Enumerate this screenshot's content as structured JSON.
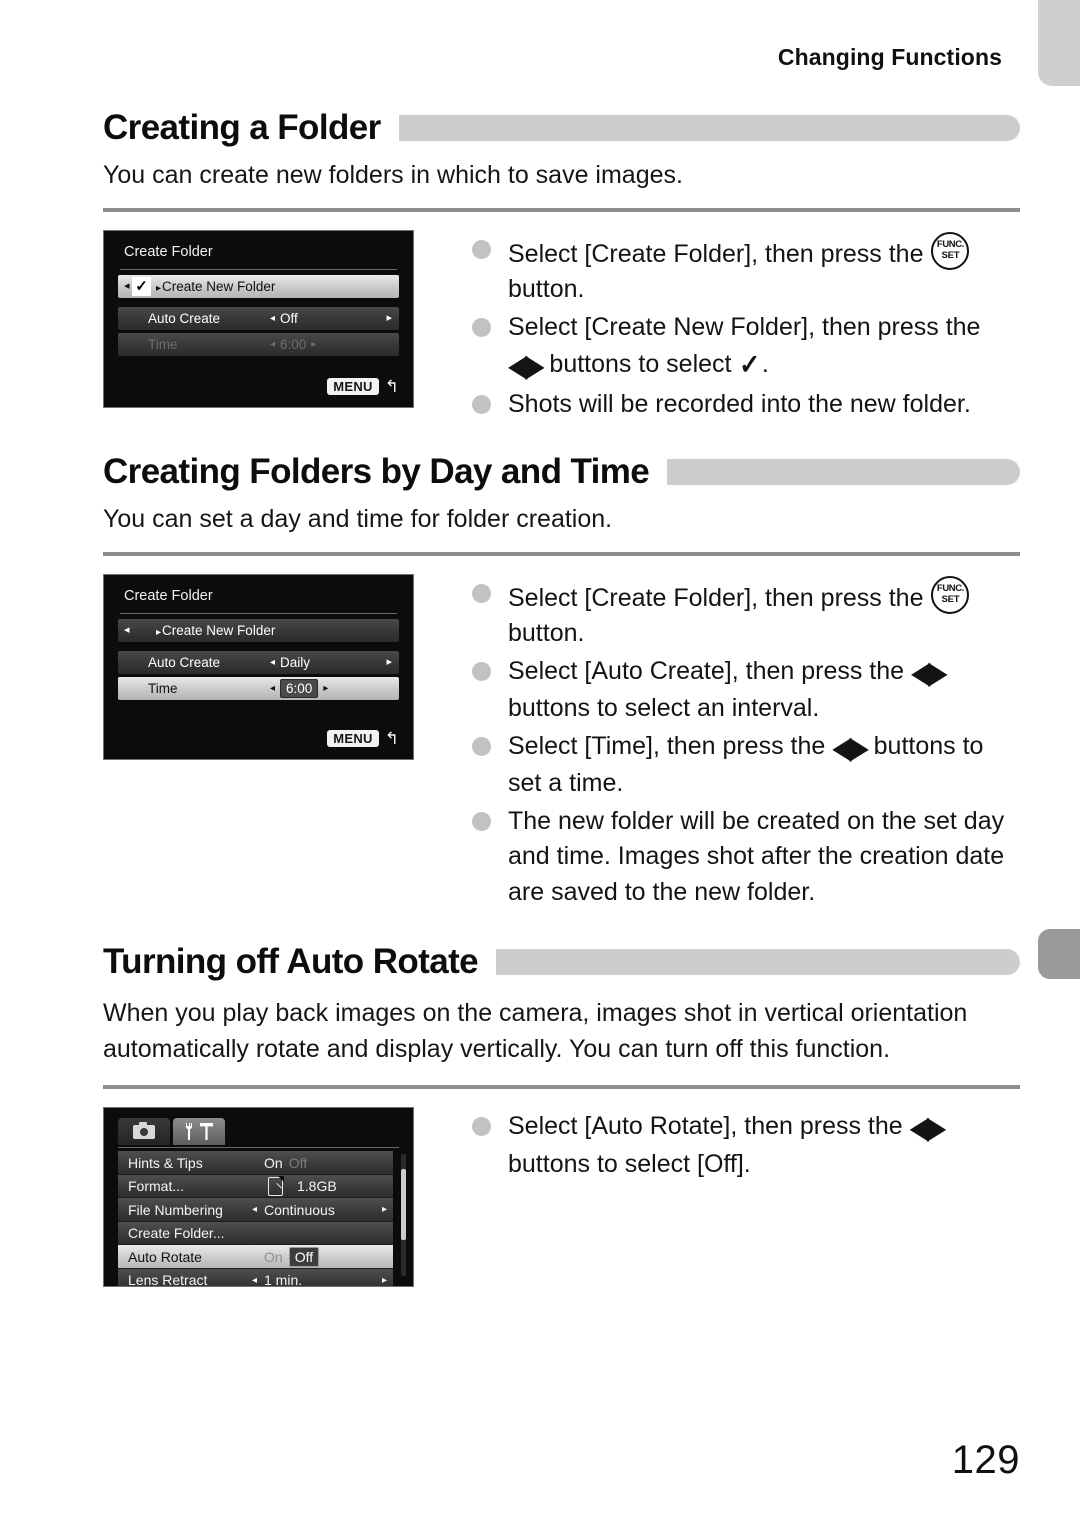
{
  "header": {
    "running_title": "Changing Functions"
  },
  "page_number": "129",
  "sections": [
    {
      "id": "creating-a-folder",
      "title": "Creating a Folder",
      "intro": "You can create new folders in which to save images.",
      "screen": {
        "title": "Create Folder",
        "rows": [
          {
            "label": "Create New Folder",
            "value": "",
            "state": "highlighted",
            "checked": true
          },
          {
            "label": "Auto Create",
            "value": "Off",
            "state": "normal",
            "checked": false
          },
          {
            "label": "Time",
            "value": "6:00",
            "state": "dimmed",
            "checked": false
          }
        ],
        "menu_button": "MENU"
      },
      "steps": [
        "Select [Create Folder], then press the FUNC-SET button.",
        "Select [Create New Folder], then press the LR buttons to select CHECK .",
        "Shots will be recorded into the new folder."
      ],
      "step_parts": [
        {
          "pre": "Select [Create Folder], then press the ",
          "icon": "func-set-icon",
          "post": " button."
        },
        {
          "pre": "Select [Create New Folder], then press the ",
          "icon": "left-right-arrows-icon",
          "post": " buttons to select ",
          "icon2": "checkmark-icon",
          "post2": "."
        },
        {
          "pre": "Shots will be recorded into the new folder.",
          "icon": "",
          "post": ""
        }
      ]
    },
    {
      "id": "creating-folders-by-day-and-time",
      "title": "Creating Folders by Day and Time",
      "intro": "You can set a day and time for folder creation.",
      "screen": {
        "title": "Create Folder",
        "rows": [
          {
            "label": "Create New Folder",
            "value": "",
            "state": "normal",
            "checked": false
          },
          {
            "label": "Auto Create",
            "value": "Daily",
            "state": "normal",
            "checked": false
          },
          {
            "label": "Time",
            "value": "6:00",
            "state": "highlighted",
            "checked": false
          }
        ],
        "menu_button": "MENU"
      },
      "step_parts": [
        {
          "pre": "Select [Create Folder], then press the ",
          "icon": "func-set-icon",
          "post": " button."
        },
        {
          "pre": "Select [Auto Create], then press the ",
          "icon": "left-right-arrows-icon",
          "post": " buttons to select an interval."
        },
        {
          "pre": "Select [Time], then press the ",
          "icon": "left-right-arrows-icon",
          "post": " buttons to set a time."
        },
        {
          "pre": "The new folder will be created on the set day and time. Images shot after the creation date are saved to the new folder.",
          "icon": "",
          "post": ""
        }
      ]
    },
    {
      "id": "turning-off-auto-rotate",
      "title": "Turning off Auto Rotate",
      "intro": "When you play back images on the camera, images shot in vertical orientation automatically rotate and display vertically. You can turn off this function.",
      "screen": {
        "tabs": [
          {
            "name": "camera-tab",
            "active": false
          },
          {
            "name": "settings-tab",
            "active": true
          }
        ],
        "rows": [
          {
            "label": "Hints & Tips",
            "value_on": "On",
            "value_off": "Off",
            "selected": "On",
            "state": "normal"
          },
          {
            "label": "Format...",
            "value": "1.8GB",
            "icon": "sd-card-icon",
            "state": "normal"
          },
          {
            "label": "File Numbering",
            "value": "Continuous",
            "arrows": true,
            "state": "normal"
          },
          {
            "label": "Create Folder...",
            "value": "",
            "state": "normal"
          },
          {
            "label": "Auto Rotate",
            "value_on": "On",
            "value_off": "Off",
            "selected": "Off",
            "state": "highlighted"
          },
          {
            "label": "Lens Retract",
            "value": "1 min.",
            "arrows": true,
            "state": "normal"
          }
        ]
      },
      "step_parts": [
        {
          "pre": "Select [Auto Rotate], then press the ",
          "icon": "left-right-arrows-icon",
          "post": " buttons to select [Off]."
        }
      ]
    }
  ],
  "glyphs": {
    "func_top": "FUNC.",
    "func_bottom": "SET",
    "left_arrow": "◀",
    "right_arrow": "▶",
    "small_left": "◂",
    "small_right": "▸",
    "checkmark": "✓",
    "back_arrow": "↰",
    "wrench": "ƒ",
    "hammer": "T"
  }
}
